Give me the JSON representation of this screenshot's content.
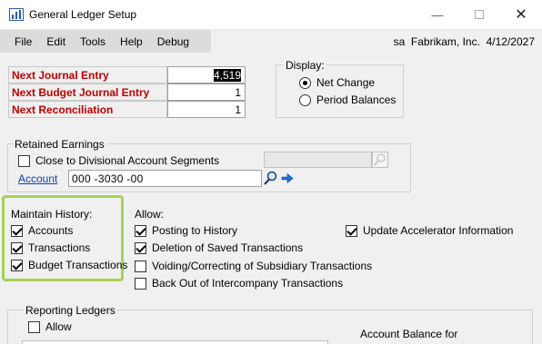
{
  "window": {
    "title": "General Ledger Setup"
  },
  "menu": {
    "items": [
      "File",
      "Edit",
      "Tools",
      "Help",
      "Debug"
    ]
  },
  "user_info": "sa  Fabrikam, Inc.  4/12/2027",
  "numbers": {
    "next_journal_entry_label": "Next Journal Entry",
    "next_journal_entry_value": "4,519",
    "next_budget_label": "Next Budget Journal Entry",
    "next_budget_value": "1",
    "next_reconciliation_label": "Next Reconciliation",
    "next_reconciliation_value": "1"
  },
  "display": {
    "legend": "Display:",
    "options": [
      "Net Change",
      "Period Balances"
    ],
    "selected": "Net Change"
  },
  "retained_earnings": {
    "legend": "Retained Earnings",
    "close_to_divisional_label": "Close to Divisional Account Segments",
    "close_to_divisional_checked": false,
    "account_label": "Account",
    "account_value": "000 -3030 -00"
  },
  "maintain_history": {
    "legend": "Maintain History:",
    "items": [
      {
        "label": "Accounts",
        "checked": true
      },
      {
        "label": "Transactions",
        "checked": true
      },
      {
        "label": "Budget Transactions",
        "checked": true
      }
    ]
  },
  "allow": {
    "legend": "Allow:",
    "items": [
      {
        "label": "Posting to History",
        "checked": true
      },
      {
        "label": "Deletion of Saved Transactions",
        "checked": true
      },
      {
        "label": "Voiding/Correcting of Subsidiary Transactions",
        "checked": false
      },
      {
        "label": "Back Out of Intercompany Transactions",
        "checked": false
      }
    ],
    "update_accelerator_label": "Update Accelerator Information",
    "update_accelerator_checked": true
  },
  "reporting_ledgers": {
    "legend": "Reporting Ledgers",
    "allow_label": "Allow",
    "allow_checked": false,
    "account_balance_label": "Account Balance for"
  },
  "colors": {
    "highlight": "#a6d255",
    "required_label": "#c00000",
    "link": "#0b3fb5"
  }
}
